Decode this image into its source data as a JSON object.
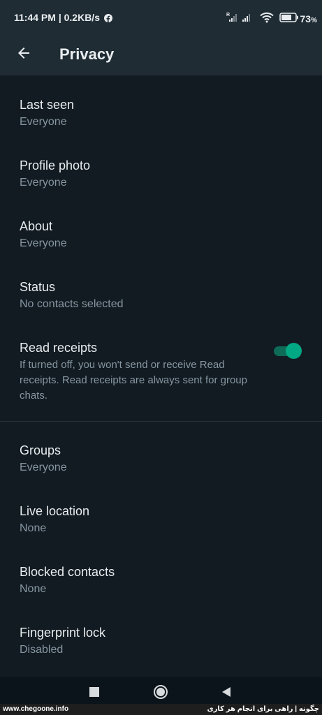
{
  "status_bar": {
    "time_and_speed": "11:44 PM | 0.2KB/s",
    "battery_percent": "73",
    "battery_unit": "%",
    "signal_roaming_label": "R",
    "icons": [
      "facebook-icon",
      "signal-icon",
      "wifi-icon",
      "battery-icon"
    ]
  },
  "toolbar": {
    "title": "Privacy",
    "back_icon": "arrow-left-icon"
  },
  "items": [
    {
      "title": "Last seen",
      "value": "Everyone"
    },
    {
      "title": "Profile photo",
      "value": "Everyone"
    },
    {
      "title": "About",
      "value": "Everyone"
    },
    {
      "title": "Status",
      "value": "No contacts selected"
    },
    {
      "title": "Read receipts",
      "description": "If turned off, you won't send or receive Read receipts. Read receipts are always sent for group chats.",
      "toggle_on": true
    },
    {
      "title": "Groups",
      "value": "Everyone"
    },
    {
      "title": "Live location",
      "value": "None"
    },
    {
      "title": "Blocked contacts",
      "value": "None"
    },
    {
      "title": "Fingerprint lock",
      "value": "Disabled"
    }
  ],
  "nav_bar": {
    "icons": [
      "recents-square-icon",
      "home-circle-icon",
      "back-triangle-icon"
    ]
  },
  "watermark": {
    "left": "www.chegoone.info",
    "right": "چگونه | راهی برای انجام هر کاری"
  },
  "colors": {
    "background": "#121b22",
    "header": "#1f2c34",
    "accent": "#00a884",
    "primary_text": "#e9edef",
    "secondary_text": "#8696a0"
  }
}
